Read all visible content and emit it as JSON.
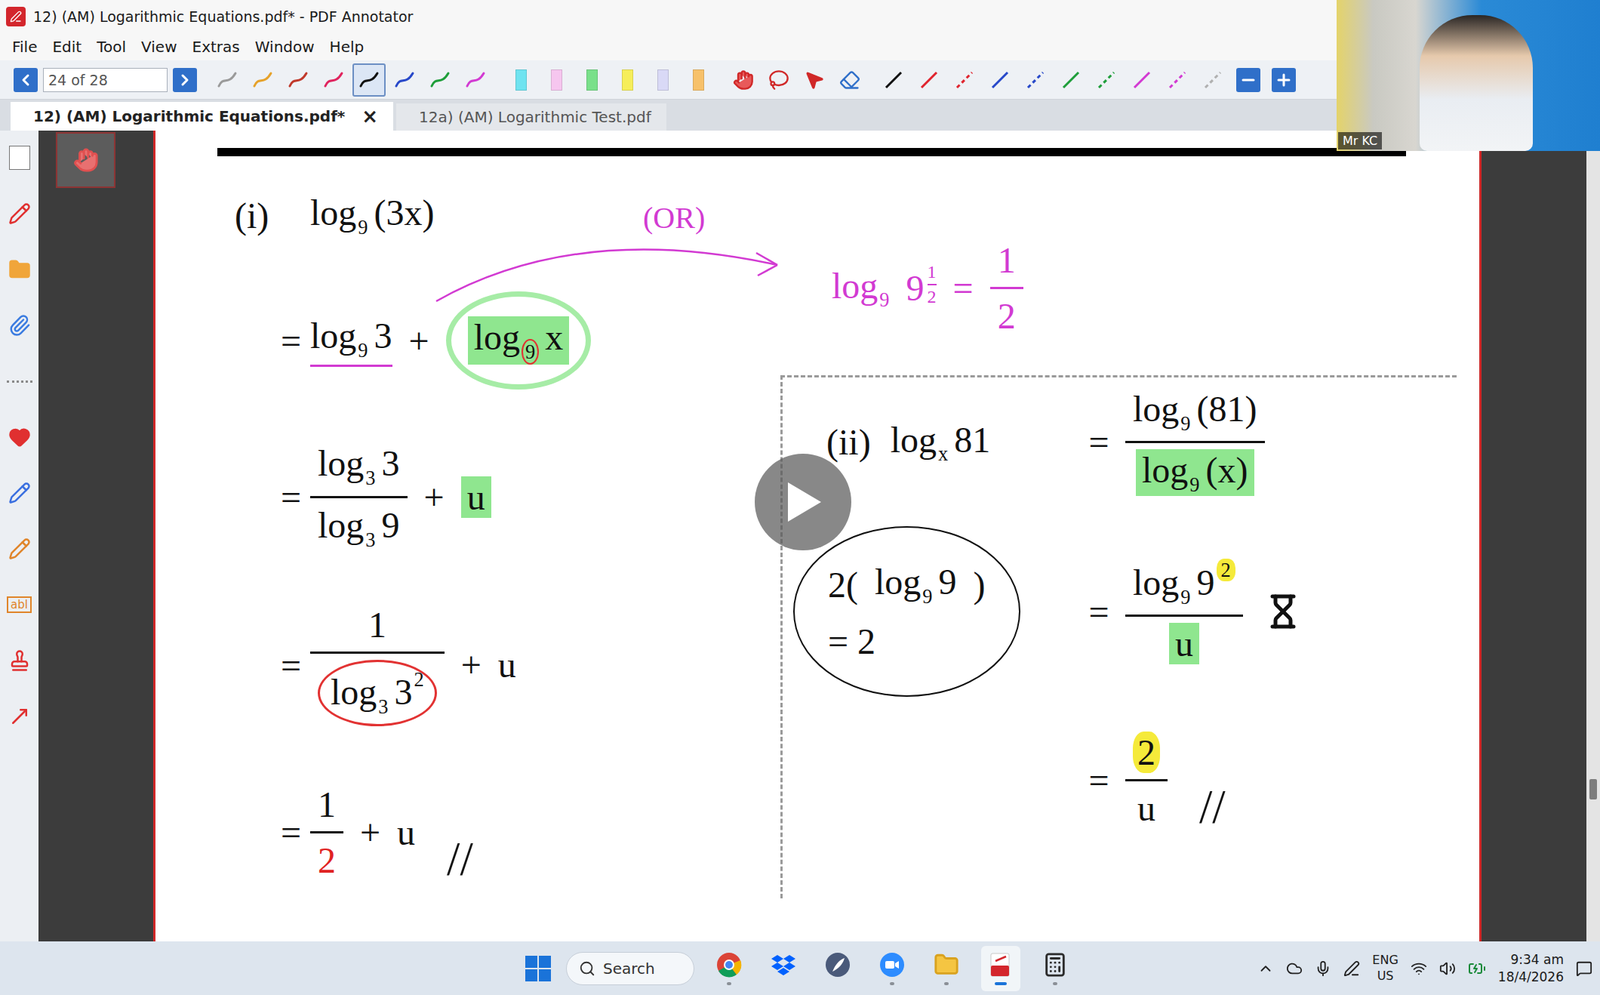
{
  "window": {
    "title": "12) (AM) Logarithmic Equations.pdf* - PDF Annotator"
  },
  "menu": [
    "File",
    "Edit",
    "Tool",
    "View",
    "Extras",
    "Window",
    "Help"
  ],
  "toolbar": {
    "page": "24 of 28",
    "pens": [
      {
        "color": "#9a9a9a",
        "selected": false
      },
      {
        "color": "#e6a22a",
        "selected": false
      },
      {
        "color": "#c0392b",
        "selected": false
      },
      {
        "color": "#e0245e",
        "selected": false
      },
      {
        "color": "#111111",
        "selected": true
      },
      {
        "color": "#2748c9",
        "selected": false
      },
      {
        "color": "#1e9e3a",
        "selected": false
      },
      {
        "color": "#d23ad2",
        "selected": false
      }
    ],
    "highlighters": [
      {
        "color": "#6fe3f0"
      },
      {
        "color": "#f6c6ef"
      },
      {
        "color": "#79e08a"
      },
      {
        "color": "#f6ee5a"
      },
      {
        "color": "#d9d9f6"
      },
      {
        "color": "#f7c16a"
      }
    ],
    "lines": [
      {
        "color": "#111111",
        "dashed": false
      },
      {
        "color": "#e0242e",
        "dashed": false
      },
      {
        "color": "#e0242e",
        "dashed": true
      },
      {
        "color": "#2748c9",
        "dashed": false
      },
      {
        "color": "#2748c9",
        "dashed": true
      },
      {
        "color": "#1e9e3a",
        "dashed": false
      },
      {
        "color": "#1e9e3a",
        "dashed": true
      },
      {
        "color": "#d23ad2",
        "dashed": false
      },
      {
        "color": "#d23ad2",
        "dashed": true
      },
      {
        "color": "#b0b0b0",
        "dashed": true
      }
    ]
  },
  "tabs": [
    {
      "label": "12) (AM) Logarithmic Equations.pdf*",
      "selected": true,
      "close": "×"
    },
    {
      "label": "12a) (AM) Logarithmic Test.pdf",
      "selected": false,
      "close": ""
    }
  ],
  "sidebar": {
    "items": [
      {
        "kind": "page",
        "color": "#ffffff",
        "text": ""
      },
      {
        "kind": "pen",
        "color": "#e03030",
        "text": ""
      },
      {
        "kind": "folder",
        "color": "#f0a53a",
        "text": ""
      },
      {
        "kind": "clip",
        "color": "#3a7be0",
        "text": ""
      },
      {
        "kind": "separator",
        "color": "#8a8a8a",
        "text": ""
      },
      {
        "kind": "heart",
        "color": "#e03030",
        "text": ""
      },
      {
        "kind": "pen",
        "color": "#3a6fe0",
        "text": ""
      },
      {
        "kind": "pen",
        "color": "#e0852a",
        "text": ""
      },
      {
        "kind": "text",
        "color": "#e0852a",
        "text": "abl"
      },
      {
        "kind": "stamp",
        "color": "#e03030",
        "text": ""
      },
      {
        "kind": "arrow",
        "color": "#e03030",
        "text": ""
      }
    ]
  },
  "webcam": {
    "name": "Mr KC"
  },
  "player": {
    "paused": true
  },
  "scrollbar": {
    "level": 0.82
  },
  "document": {
    "top_note": {
      "label": "(OR)",
      "expr": [
        {
          "kind": "log",
          "fn": "log",
          "base": "9",
          "arg": ""
        },
        {
          "kind": "power",
          "base": "9",
          "top": "1",
          "bottom": "2"
        },
        {
          "kind": "text",
          "text": "="
        },
        {
          "kind": "frac",
          "top": [
            {
              "kind": "text",
              "text": "1"
            }
          ],
          "bottom": [
            {
              "kind": "text",
              "text": "2"
            }
          ]
        }
      ]
    },
    "left": [
      {
        "kind": "label",
        "lead": "(i)",
        "expr": [
          {
            "kind": "log",
            "fn": "log",
            "base": "9",
            "arg": "(3x)"
          }
        ]
      },
      {
        "kind": "step",
        "lead": "=",
        "expr": [
          {
            "kind": "log",
            "fn": "log",
            "base": "9",
            "arg": "3",
            "mark": "underline"
          },
          {
            "kind": "text",
            "text": "+"
          },
          {
            "kind": "log",
            "fn": "log",
            "base": "9",
            "arg": "x",
            "mark": "green",
            "ring": "green",
            "base_ring": "red"
          }
        ]
      },
      {
        "kind": "step",
        "lead": "=",
        "expr": [
          {
            "kind": "frac",
            "top": [
              {
                "kind": "log",
                "fn": "log",
                "base": "3",
                "arg": "3"
              }
            ],
            "bottom": [
              {
                "kind": "log",
                "fn": "log",
                "base": "3",
                "arg": "9"
              }
            ]
          },
          {
            "kind": "text",
            "text": "+"
          },
          {
            "kind": "text",
            "text": "u",
            "mark": "green"
          }
        ]
      },
      {
        "kind": "step",
        "lead": "=",
        "expr": [
          {
            "kind": "frac",
            "top": [
              {
                "kind": "text",
                "text": "1"
              }
            ],
            "bottom": [
              {
                "kind": "log",
                "fn": "log",
                "base": "3",
                "arg": "3",
                "sup": "2",
                "ring": "red"
              }
            ]
          },
          {
            "kind": "text",
            "text": "+"
          },
          {
            "kind": "text",
            "text": "u"
          }
        ]
      },
      {
        "kind": "step",
        "lead": "=",
        "expr": [
          {
            "kind": "frac",
            "top": [
              {
                "kind": "text",
                "text": "1"
              }
            ],
            "bottom": [
              {
                "kind": "text",
                "text": "2",
                "mark": "red"
              }
            ]
          },
          {
            "kind": "text",
            "text": "+"
          },
          {
            "kind": "text",
            "text": "u"
          },
          {
            "kind": "text",
            "text": "//",
            "mark": "done"
          }
        ]
      }
    ],
    "right": [
      {
        "lead": [
          {
            "kind": "text",
            "text": "(ii)"
          },
          {
            "kind": "log",
            "fn": "log",
            "base": "x",
            "arg": "81"
          }
        ],
        "note": [],
        "eq": "=",
        "expr": [
          {
            "kind": "frac",
            "top": [
              {
                "kind": "log",
                "fn": "log",
                "base": "9",
                "arg": "(81)"
              }
            ],
            "bottom": [
              {
                "kind": "log",
                "fn": "log",
                "base": "9",
                "arg": "(x)",
                "mark": "green"
              }
            ]
          }
        ],
        "busy": false
      },
      {
        "lead": [],
        "note": [
          [
            {
              "kind": "text",
              "text": "2("
            },
            {
              "kind": "log",
              "fn": "log",
              "base": "9",
              "arg": "9"
            },
            {
              "kind": "text",
              "text": ")"
            }
          ],
          [
            {
              "kind": "text",
              "text": "= 2"
            }
          ]
        ],
        "eq": "=",
        "expr": [
          {
            "kind": "frac",
            "top": [
              {
                "kind": "log",
                "fn": "log",
                "base": "9",
                "arg": "9",
                "sup": "2",
                "sup_mark": "yellow"
              }
            ],
            "bottom": [
              {
                "kind": "text",
                "text": "u",
                "mark": "green"
              }
            ]
          }
        ],
        "busy": true
      },
      {
        "lead": [],
        "note": [],
        "eq": "=",
        "expr": [
          {
            "kind": "frac",
            "top": [
              {
                "kind": "text",
                "text": "2",
                "mark": "yellow"
              }
            ],
            "bottom": [
              {
                "kind": "text",
                "text": "u"
              }
            ]
          },
          {
            "kind": "text",
            "text": "//",
            "mark": "done"
          }
        ],
        "busy": false
      }
    ]
  },
  "taskbar": {
    "search": "Search",
    "apps": [
      {
        "kind": "chrome",
        "running": true,
        "active": false
      },
      {
        "kind": "dropbox",
        "running": false,
        "active": false
      },
      {
        "kind": "feather",
        "running": false,
        "active": false
      },
      {
        "kind": "zoom",
        "running": true,
        "active": false
      },
      {
        "kind": "folder",
        "running": true,
        "active": false
      },
      {
        "kind": "pdf",
        "running": true,
        "active": true
      },
      {
        "kind": "calculator",
        "running": true,
        "active": false
      }
    ],
    "language": "ENG",
    "region": "US",
    "time": "9:34 am",
    "date": "18/4/2026"
  }
}
